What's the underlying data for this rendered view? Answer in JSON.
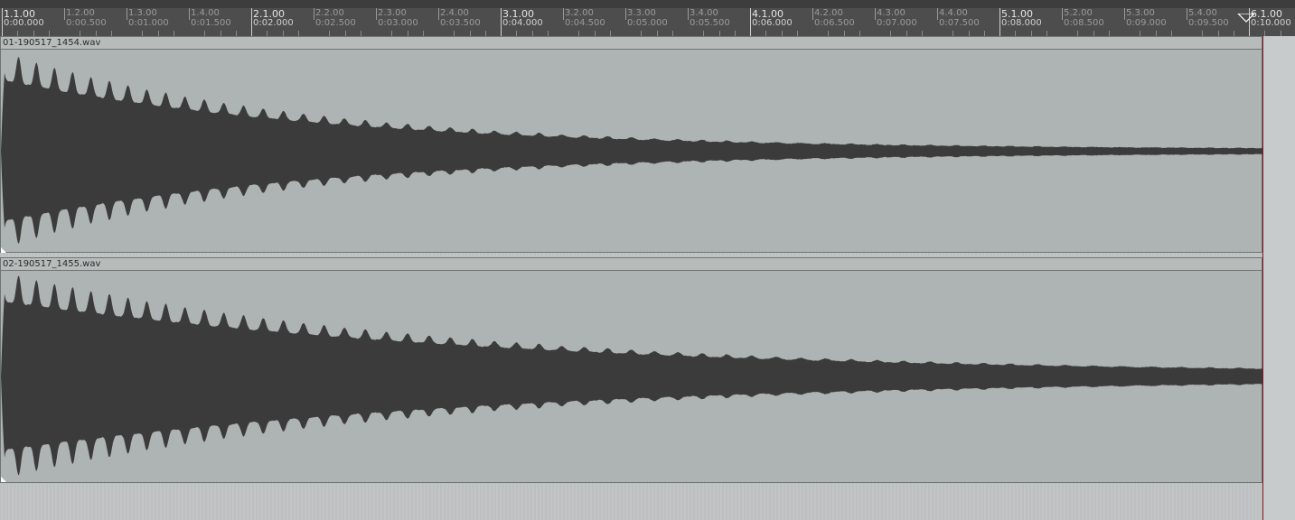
{
  "ruler": {
    "major_measures": [
      "1.1.00",
      "2.1.00",
      "3.1.00",
      "4.1.00",
      "5.1.00",
      "6.1.00"
    ],
    "major_times": [
      "0:00.000",
      "0:02.000",
      "0:04.000",
      "0:06.000",
      "0:08.000",
      "0:10.000"
    ],
    "minor_measures": [
      "1.2.00",
      "1.3.00",
      "1.4.00",
      "2.2.00",
      "2.3.00",
      "2.4.00",
      "3.2.00",
      "3.3.00",
      "3.4.00",
      "4.2.00",
      "4.3.00",
      "4.4.00",
      "5.2.00",
      "5.3.00",
      "5.4.00"
    ],
    "minor_times": [
      "0:00.500",
      "0:01.000",
      "0:01.500",
      "0:02.500",
      "0:03.000",
      "0:03.500",
      "0:04.500",
      "0:05.000",
      "0:05.500",
      "0:06.500",
      "0:07.000",
      "0:07.500",
      "0:08.500",
      "0:09.000",
      "0:09.500"
    ]
  },
  "tracks": [
    {
      "item_name": "01-190517_1454.wav"
    },
    {
      "item_name": "02-190517_1455.wav"
    }
  ],
  "colors": {
    "ruler_bg": "#4d4d4d",
    "item_bg": "#aeb4b3",
    "waveform": "#3b3b3b",
    "end_marker": "#7a1f2a"
  }
}
